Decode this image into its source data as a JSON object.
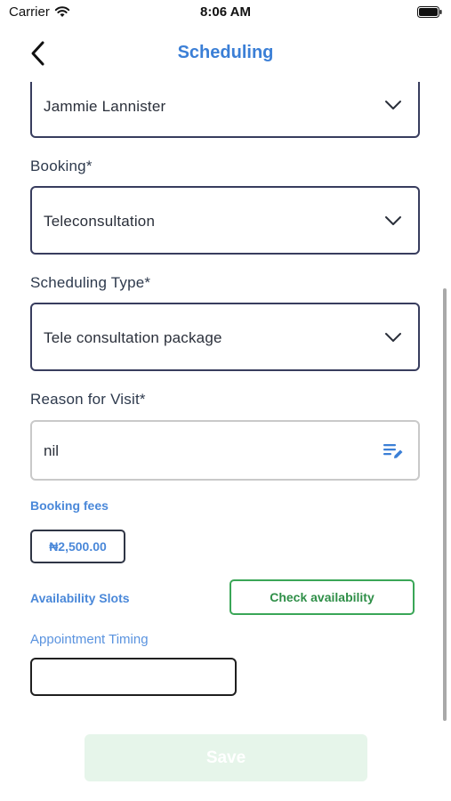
{
  "status_bar": {
    "carrier": "Carrier",
    "time": "8:06 AM",
    "icons": [
      "wifi-icon",
      "battery-icon"
    ]
  },
  "nav": {
    "title": "Scheduling",
    "back_icon": "chevron-left-icon"
  },
  "form": {
    "patient": {
      "value": "Jammie Lannister"
    },
    "booking": {
      "label": "Booking*",
      "value": "Teleconsultation"
    },
    "scheduling_type": {
      "label": "Scheduling Type*",
      "value": "Tele consultation package"
    },
    "reason": {
      "label": "Reason for Visit*",
      "value": "nil",
      "icon": "edit-notes-icon"
    },
    "booking_fees": {
      "label": "Booking fees",
      "amount": "₦2,500.00"
    },
    "availability": {
      "label": "Availability Slots",
      "button_label": "Check availability"
    },
    "appointment_timing": {
      "label": "Appointment Timing",
      "value": ""
    },
    "save_label": "Save"
  },
  "colors": {
    "title_blue": "#3b7fd6",
    "label_blue": "#4a88d9",
    "success_green": "#3aa657",
    "disabled_save_bg": "#e6f5ea",
    "field_border": "#383d5e"
  }
}
